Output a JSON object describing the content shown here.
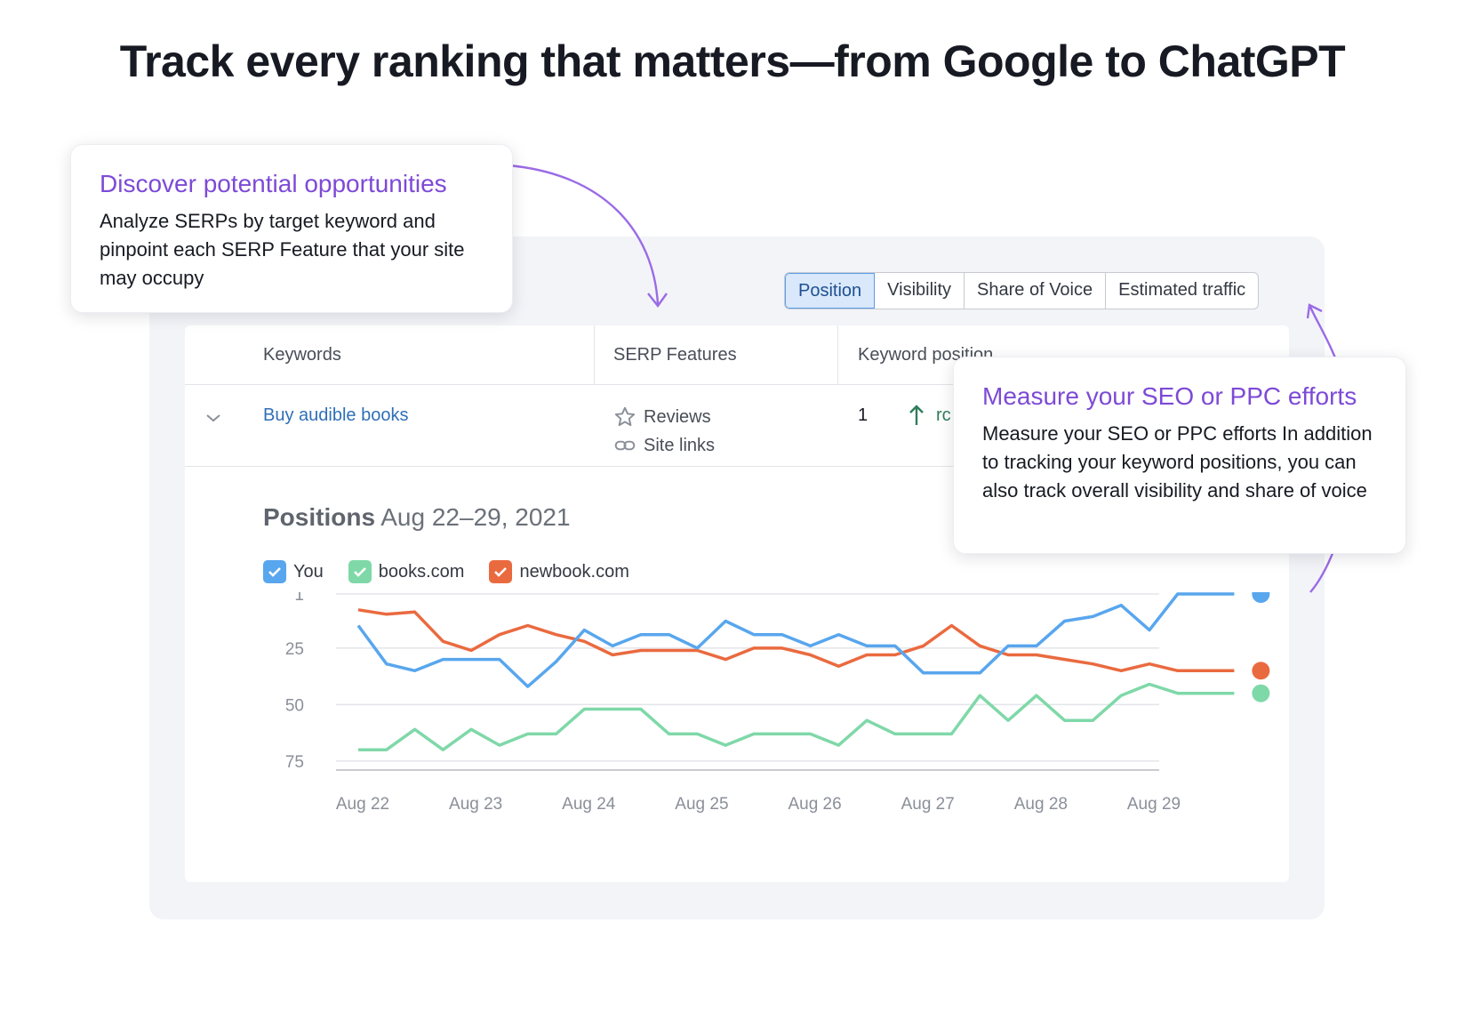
{
  "headline": "Track every ranking that matters—from Google to ChatGPT",
  "tabs": [
    {
      "label": "Position",
      "active": true
    },
    {
      "label": "Visibility",
      "active": false
    },
    {
      "label": "Share of Voice",
      "active": false
    },
    {
      "label": "Estimated traffic",
      "active": false
    }
  ],
  "table": {
    "headers": [
      "Keywords",
      "SERP Features",
      "Keyword position"
    ],
    "row": {
      "keyword": "Buy audible books",
      "features": [
        {
          "icon": "star-outline-icon",
          "label": "Reviews"
        },
        {
          "icon": "link-icon",
          "label": "Site links"
        }
      ],
      "position": "1",
      "position_trend": "up",
      "truncated_text": "rc"
    }
  },
  "chart_header": {
    "title_bold": "Positions",
    "date_range": "Aug 22–29, 2021"
  },
  "legend": [
    {
      "label": "You",
      "color": "#58a6ee"
    },
    {
      "label": "books.com",
      "color": "#7fd8a8"
    },
    {
      "label": "newbook.com",
      "color": "#ea6a3f"
    }
  ],
  "callouts": [
    {
      "title": "Discover potential opportunities",
      "body": "Analyze SERPs by target keyword and pinpoint each SERP Feature that your site may occupy"
    },
    {
      "title": "Measure your SEO or PPC efforts",
      "body": "Measure your SEO or PPC efforts In addition to tracking your keyword positions, you can also track overall visibility and share of voice"
    }
  ],
  "colors": {
    "accent_purple": "#7d4ad6",
    "link_blue": "#2f6fb7",
    "you": "#58a6ee",
    "books": "#7fd8a8",
    "newbook": "#ea6a3f"
  },
  "chart_data": {
    "type": "line",
    "title": "Positions",
    "subtitle": "Aug 22–29, 2021",
    "x_ticks": [
      "Aug 22",
      "Aug 23",
      "Aug 24",
      "Aug 25",
      "Aug 26",
      "Aug 27",
      "Aug 28",
      "Aug 29"
    ],
    "y_ticks": [
      1,
      25,
      50,
      75
    ],
    "y_inverted": true,
    "ylim": [
      1,
      79
    ],
    "points_per_day": 4,
    "series": [
      {
        "name": "You",
        "color": "#58a6ee",
        "values": [
          15,
          32,
          35,
          30,
          30,
          30,
          42,
          31,
          17,
          24,
          19,
          19,
          25,
          13,
          19,
          19,
          24,
          19,
          24,
          24,
          36,
          36,
          36,
          24,
          24,
          13,
          11,
          6,
          17,
          1,
          1,
          1
        ]
      },
      {
        "name": "books.com",
        "color": "#7fd8a8",
        "values": [
          70,
          70,
          61,
          70,
          61,
          68,
          63,
          63,
          52,
          52,
          52,
          63,
          63,
          68,
          63,
          63,
          63,
          68,
          57,
          63,
          63,
          63,
          46,
          57,
          46,
          57,
          57,
          46,
          41,
          45,
          45,
          45
        ]
      },
      {
        "name": "newbook.com",
        "color": "#ea6a3f",
        "values": [
          8,
          10,
          9,
          22,
          26,
          19,
          15,
          19,
          22,
          28,
          26,
          26,
          26,
          30,
          25,
          25,
          28,
          33,
          28,
          28,
          24,
          15,
          24,
          28,
          28,
          30,
          32,
          35,
          32,
          35,
          35,
          35
        ]
      }
    ]
  }
}
